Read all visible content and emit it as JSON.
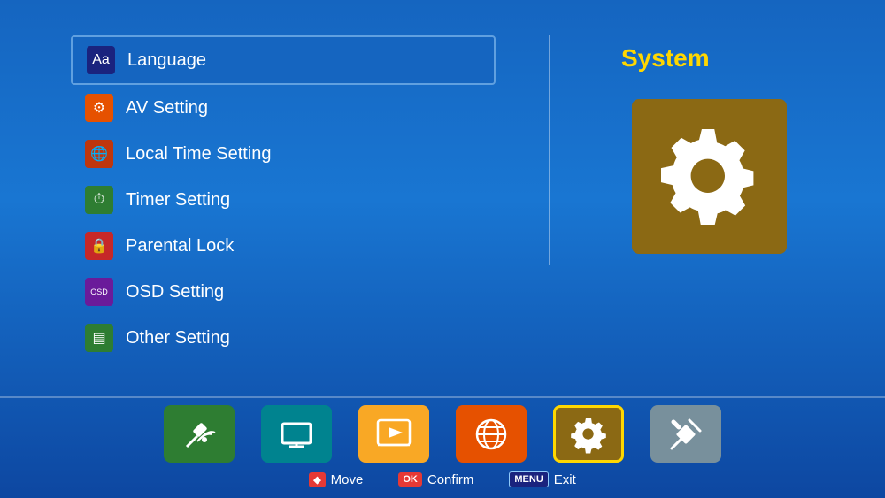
{
  "header": {
    "system_label": "System"
  },
  "menu": {
    "items": [
      {
        "id": "language",
        "label": "Language",
        "icon_bg": "#1a237e",
        "icon_symbol": "Aa",
        "active": true
      },
      {
        "id": "av-setting",
        "label": "AV Setting",
        "icon_bg": "#e65100",
        "icon_symbol": "⚙",
        "active": false
      },
      {
        "id": "local-time",
        "label": "Local Time Setting",
        "icon_bg": "#bf360c",
        "icon_symbol": "🌐",
        "active": false
      },
      {
        "id": "timer",
        "label": "Timer Setting",
        "icon_bg": "#2e7d32",
        "icon_symbol": "⏰",
        "active": false
      },
      {
        "id": "parental-lock",
        "label": "Parental Lock",
        "icon_bg": "#c62828",
        "icon_symbol": "🔒",
        "active": false
      },
      {
        "id": "osd",
        "label": "OSD Setting",
        "icon_bg": "#6a1b9a",
        "icon_symbol": "OSD",
        "active": false
      },
      {
        "id": "other-setting",
        "label": "Other Setting",
        "icon_bg": "#2e7d32",
        "icon_symbol": "⊟",
        "active": false
      }
    ]
  },
  "nav_icons": [
    {
      "id": "satellite",
      "color": "#2e7d32",
      "symbol": "📡"
    },
    {
      "id": "tv",
      "color": "#00838f",
      "symbol": "📺"
    },
    {
      "id": "media",
      "color": "#f9a825",
      "symbol": "▶"
    },
    {
      "id": "internet",
      "color": "#e65100",
      "symbol": "🌐"
    },
    {
      "id": "system",
      "color": "#8b6914",
      "symbol": "⚙",
      "active": true
    },
    {
      "id": "tools",
      "color": "#78909c",
      "symbol": "🔧"
    }
  ],
  "bottom_controls": [
    {
      "badge": "◆",
      "badge_color": "#e53935",
      "label": "Move"
    },
    {
      "badge": "OK",
      "badge_color": "#e53935",
      "label": "Confirm"
    },
    {
      "badge": "MENU",
      "badge_color": "#1a237e",
      "label": "Exit"
    }
  ]
}
